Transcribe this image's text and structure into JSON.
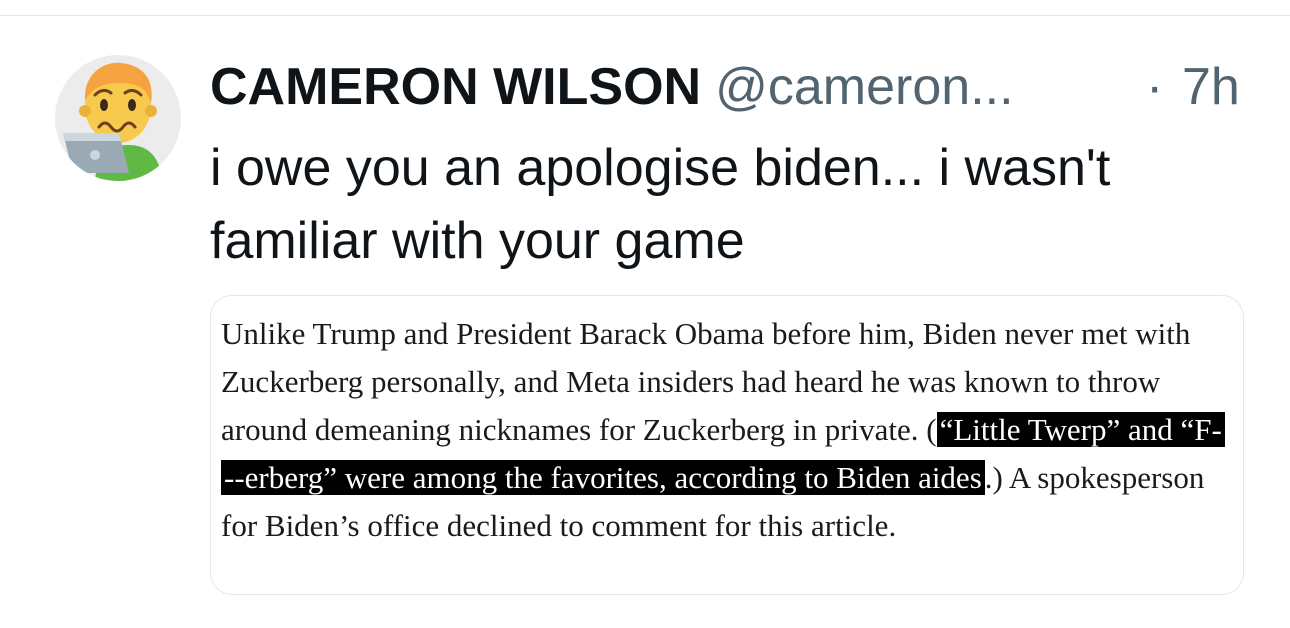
{
  "tweet": {
    "display_name": "CAMERON WILSON",
    "handle": "@cameron...",
    "separator": "·",
    "time": "7h",
    "avatar_icon": "worried-face-laptop-icon",
    "text": "i owe you an apologise biden... i wasn't familiar with your game"
  },
  "media": {
    "text_before": "Unlike Trump and President Barack Obama before him, Biden never met with Zuckerberg personally, and Meta insiders had heard he was known to throw around demeaning nicknames for Zuckerberg in private. (",
    "highlighted": "“Little Twerp” and “F---erberg” were among the favorites, according to Biden aides",
    "text_after": ".) A spokesperson for Biden’s office declined to comment for this article.",
    "highlight_color": "#000000"
  },
  "colors": {
    "text_primary": "#0f1419",
    "text_secondary": "#536471",
    "border": "#e6e6e6"
  }
}
